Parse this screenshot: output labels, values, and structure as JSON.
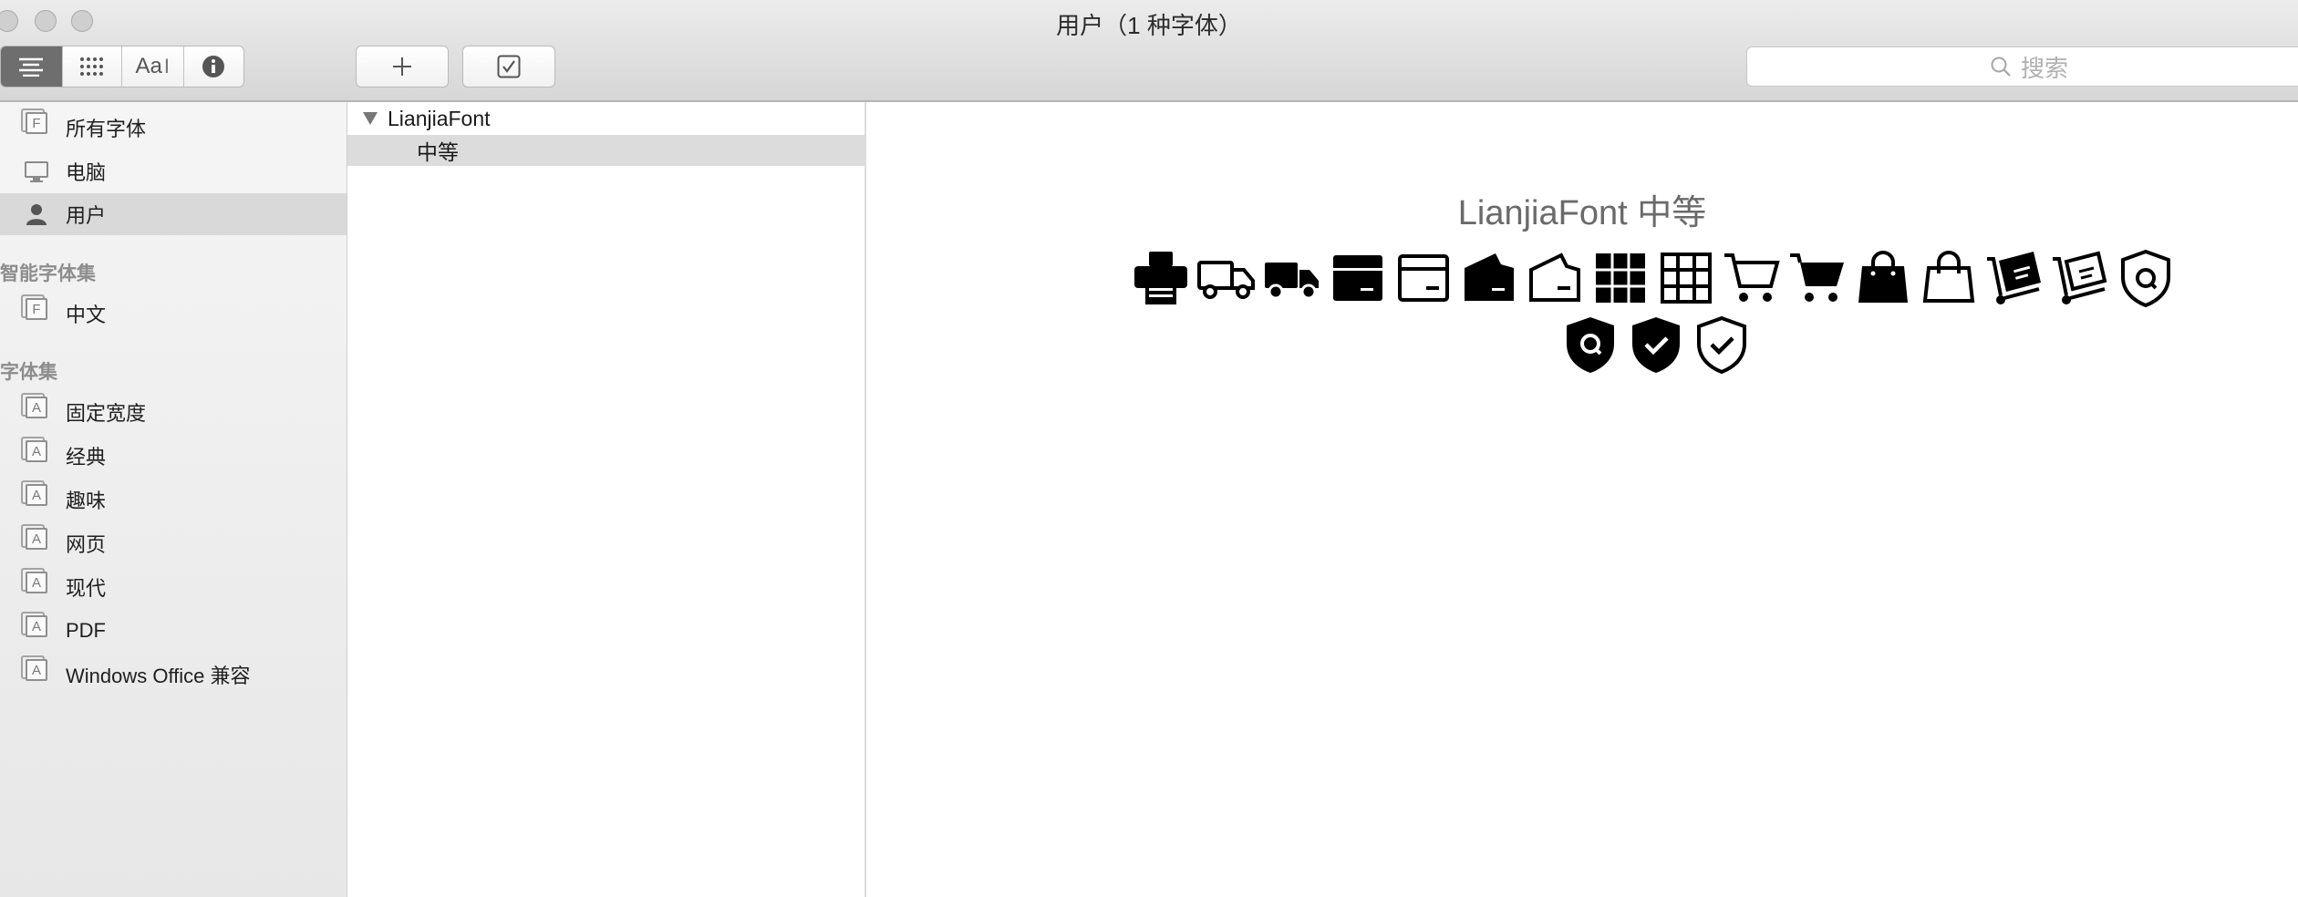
{
  "window": {
    "title": "用户（1 种字体）"
  },
  "toolbar": {
    "view_buttons": [
      "list-view",
      "grid-view",
      "sample-view",
      "info-view"
    ],
    "sample_label": "Aa",
    "add_label": "+",
    "search_placeholder": "搜索"
  },
  "sidebar": {
    "library_items": [
      {
        "label": "所有字体",
        "icon": "font-book-icon"
      },
      {
        "label": "电脑",
        "icon": "computer-icon"
      },
      {
        "label": "用户",
        "icon": "user-icon",
        "selected": true
      }
    ],
    "smart_heading": "智能字体集",
    "smart_items": [
      {
        "label": "中文",
        "icon": "font-book-icon"
      }
    ],
    "collections_heading": "字体集",
    "collections": [
      {
        "label": "固定宽度"
      },
      {
        "label": "经典"
      },
      {
        "label": "趣味"
      },
      {
        "label": "网页"
      },
      {
        "label": "现代"
      },
      {
        "label": "PDF"
      },
      {
        "label": "Windows Office 兼容"
      }
    ],
    "collection_icon_letter": "A",
    "font_book_icon_letter": "F"
  },
  "font_list": {
    "family": "LianjiaFont",
    "styles": [
      "中等"
    ]
  },
  "preview": {
    "title": "LianjiaFont 中等",
    "glyphs_row1": [
      "printer-icon",
      "truck-outline-icon",
      "truck-filled-icon",
      "box-filled-icon",
      "box-outline-icon",
      "box-open-filled-icon",
      "box-open-outline-icon",
      "grid-filled-icon",
      "grid-outline-icon",
      "cart-outline-icon",
      "cart-filled-icon",
      "bag-filled-icon",
      "bag-outline-icon",
      "hand-truck-filled-icon",
      "hand-truck-outline-icon",
      "shield-q-outline-icon"
    ],
    "glyphs_row2": [
      "shield-q-filled-icon",
      "shield-check-filled-icon",
      "shield-check-outline-icon"
    ]
  },
  "colors": {
    "selection": "#d9d9d9",
    "active_segment": "#6e6e6e",
    "sidebar_heading": "#8d8d8d"
  }
}
